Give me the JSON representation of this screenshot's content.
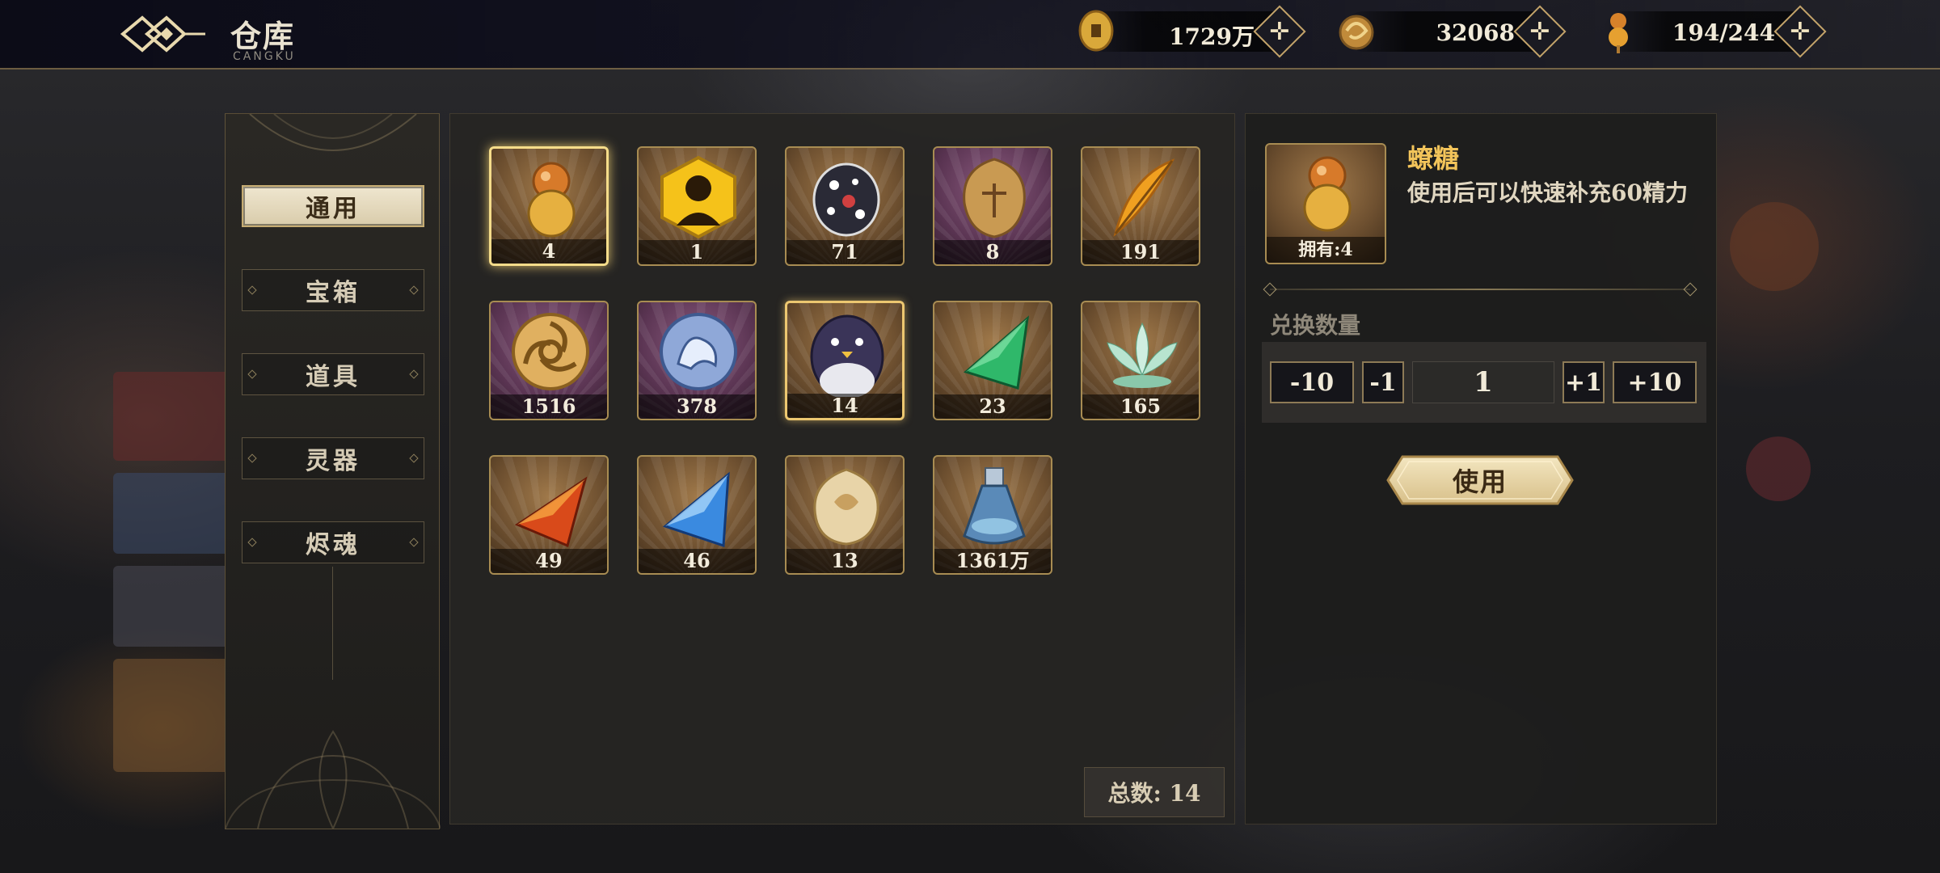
{
  "header": {
    "title": "仓库",
    "subtitle": "CANGKU"
  },
  "resources": [
    {
      "icon": "coin-icon",
      "value": "1729万"
    },
    {
      "icon": "dragon-token-icon",
      "value": "32068"
    },
    {
      "icon": "candy-stamina-icon",
      "value": "194/244"
    }
  ],
  "categories": [
    {
      "label": "通用",
      "active": true
    },
    {
      "label": "宝箱",
      "active": false
    },
    {
      "label": "道具",
      "active": false
    },
    {
      "label": "灵器",
      "active": false
    },
    {
      "label": "烬魂",
      "active": false
    }
  ],
  "items": [
    {
      "icon": "candy-gourd-icon",
      "count": "4",
      "frame": "gold",
      "selected": true
    },
    {
      "icon": "golden-portrait-icon",
      "count": "1",
      "frame": "gold"
    },
    {
      "icon": "spotted-mask-icon",
      "count": "71",
      "frame": "gold"
    },
    {
      "icon": "gold-talisman-icon",
      "count": "8",
      "frame": "purple"
    },
    {
      "icon": "golden-feather-icon",
      "count": "191",
      "frame": "gold"
    },
    {
      "icon": "triskelion-coin-icon",
      "count": "1516",
      "frame": "purple"
    },
    {
      "icon": "silver-beast-coin-icon",
      "count": "378",
      "frame": "purple"
    },
    {
      "icon": "penguin-egg-icon",
      "count": "14",
      "frame": "gold",
      "highlight": true
    },
    {
      "icon": "green-crystal-icon",
      "count": "23",
      "frame": "gold"
    },
    {
      "icon": "jade-lotus-icon",
      "count": "165",
      "frame": "gold"
    },
    {
      "icon": "red-crystal-icon",
      "count": "49",
      "frame": "gold"
    },
    {
      "icon": "blue-crystal-icon",
      "count": "46",
      "frame": "gold"
    },
    {
      "icon": "crystal-orb-icon",
      "count": "13",
      "frame": "gold"
    },
    {
      "icon": "potion-bottle-icon",
      "count": "1361万",
      "frame": "gold"
    }
  ],
  "total": "总数: 14",
  "detail": {
    "name": "蟟糖",
    "description": "使用后可以快速补充60精力",
    "owned": "拥有:4",
    "exchange_label": "兑换数量",
    "minus10": "-10",
    "minus1": "-1",
    "quantity": "1",
    "plus1": "+1",
    "plus10": "+10",
    "use_label": "使用"
  },
  "colors": {
    "accent_gold": "#f2c45a",
    "frame_gold": "#a88c52",
    "panel_dark": "#1e1d1b"
  }
}
